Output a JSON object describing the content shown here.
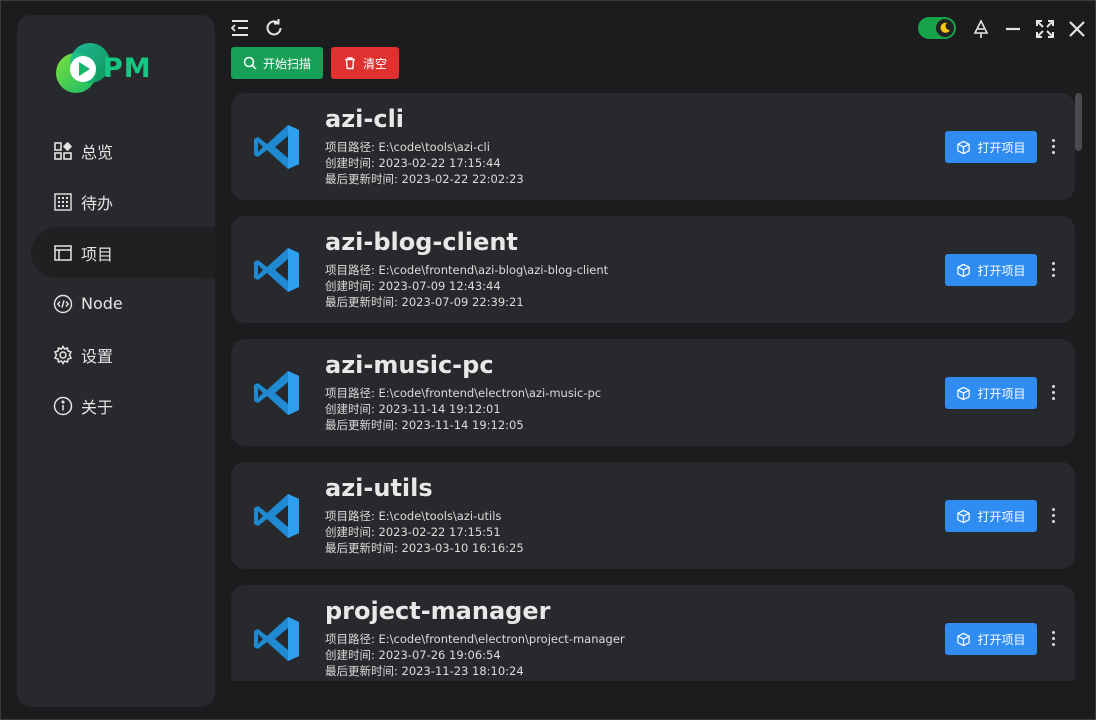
{
  "app": {
    "logo_text": "PM",
    "accent": "#16c784"
  },
  "sidebar": {
    "items": [
      {
        "label": "总览",
        "icon": "dashboard-icon"
      },
      {
        "label": "待办",
        "icon": "calendar-grid-icon"
      },
      {
        "label": "项目",
        "icon": "window-icon",
        "active": true
      },
      {
        "label": "Node",
        "icon": "code-icon"
      },
      {
        "label": "设置",
        "icon": "gear-icon"
      },
      {
        "label": "关于",
        "icon": "info-icon"
      }
    ]
  },
  "toolbar": {
    "scan_label": "开始扫描",
    "clear_label": "清空",
    "scan_color": "#18a058",
    "clear_color": "#e03131"
  },
  "projects": [
    {
      "name": "azi-cli",
      "path": "项目路径: E:\\code\\tools\\azi-cli",
      "created": "创建时间:  2023-02-22 17:15:44",
      "updated": "最后更新时间:  2023-02-22 22:02:23",
      "open_label": "打开项目"
    },
    {
      "name": "azi-blog-client",
      "path": "项目路径: E:\\code\\frontend\\azi-blog\\azi-blog-client",
      "created": "创建时间:  2023-07-09 12:43:44",
      "updated": "最后更新时间:  2023-07-09 22:39:21",
      "open_label": "打开项目"
    },
    {
      "name": "azi-music-pc",
      "path": "项目路径: E:\\code\\frontend\\electron\\azi-music-pc",
      "created": "创建时间:  2023-11-14 19:12:01",
      "updated": "最后更新时间:  2023-11-14 19:12:05",
      "open_label": "打开项目"
    },
    {
      "name": "azi-utils",
      "path": "项目路径: E:\\code\\tools\\azi-utils",
      "created": "创建时间:  2023-02-22 17:15:51",
      "updated": "最后更新时间:  2023-03-10 16:16:25",
      "open_label": "打开项目"
    },
    {
      "name": "project-manager",
      "path": "项目路径: E:\\code\\frontend\\electron\\project-manager",
      "created": "创建时间:  2023-07-26 19:06:54",
      "updated": "最后更新时间:  2023-11-23 18:10:24",
      "open_label": "打开项目"
    }
  ],
  "colors": {
    "primary": "#2f8cf0",
    "toggle": "#16a34a"
  }
}
